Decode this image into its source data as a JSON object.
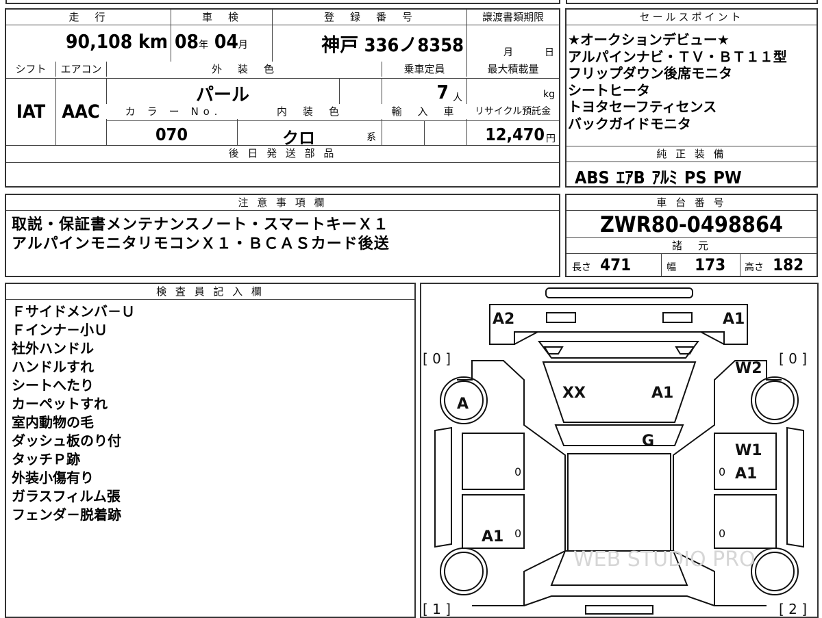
{
  "main": {
    "mileage": {
      "label": "走　行",
      "value": "90,108",
      "unit": "km"
    },
    "inspection": {
      "label": "車　検",
      "year": "08",
      "year_unit": "年",
      "month": "04",
      "month_unit": "月"
    },
    "registration": {
      "label": "登　録　番　号",
      "value": "神戸 336ノ8358"
    },
    "transfer_deadline": {
      "label": "譲渡書類期限",
      "month_unit": "月",
      "day_unit": "日"
    },
    "shift": {
      "label": "シフト",
      "value": "IAT"
    },
    "aircon": {
      "label": "エアコン",
      "value": "AAC"
    },
    "exterior_color": {
      "label": "外　装　色",
      "value": "パール"
    },
    "capacity": {
      "label": "乗車定員",
      "value": "7",
      "unit": "人"
    },
    "max_load": {
      "label": "最大積載量",
      "unit": "kg"
    },
    "color_no": {
      "label": "カ　ラ　ー　N o .",
      "value": "070"
    },
    "interior_color": {
      "label": "内　装　色",
      "value": "クロ",
      "unit": "系"
    },
    "import": {
      "label": "輸　入　車"
    },
    "recycle": {
      "label": "リサイクル預託金",
      "value": "12,470",
      "unit": "円"
    },
    "later_parts": {
      "label": "後 日 発 送 部 品"
    }
  },
  "sales_points": {
    "label": "セールスポイント",
    "lines": [
      "★オークションデビュー★",
      "アルパインナビ・ＴＶ・ＢＴ１１型",
      "フリップダウン後席モニタ",
      "シートヒータ",
      "トヨタセーフティセンス",
      "バックガイドモニタ"
    ]
  },
  "equipment": {
    "label": "純 正 装 備",
    "items": [
      "ABS",
      "ｴｱB",
      "ｱﾙﾐ",
      "PS",
      "PW"
    ]
  },
  "notes": {
    "label": "注 意 事 項 欄",
    "lines": [
      "取説・保証書メンテナンスノート・スマートキーＸ１",
      "アルパインモニタリモコンＸ１・ＢＣＡＳカード後送"
    ]
  },
  "chassis": {
    "label": "車 台 番 号",
    "value": "ZWR80-0498864"
  },
  "specs": {
    "label": "諸　元",
    "length_label": "長さ",
    "length": "471",
    "width_label": "幅",
    "width": "173",
    "height_label": "高さ",
    "height": "182"
  },
  "inspector": {
    "label": "検 査 員 記 入 欄",
    "lines": [
      "Ｆサイドメンバ－Ｕ",
      "Ｆインナ－小Ｕ",
      "社外ハンドル",
      "ハンドルすれ",
      "シートへたり",
      "カーペットすれ",
      "室内動物の毛",
      "ダッシュ板のり付",
      "タッチＰ跡",
      "外装小傷有り",
      "ガラスフィルム張",
      "フェンダ－脱着跡"
    ]
  },
  "diagram": {
    "marks": {
      "a2": "A2",
      "a1_front": "A1",
      "w2": "W2",
      "xx": "XX",
      "a1_glass": "A1",
      "a": "A",
      "g": "G",
      "w1": "W1",
      "a1_right": "A1",
      "a1_rear": "A1"
    },
    "tires": {
      "fl": "[ 0 ]",
      "fr": "[ 0 ]",
      "rl": "[ 1 ]",
      "rr": "[ 2 ]"
    },
    "zeros": [
      "0",
      "0",
      "0",
      "0"
    ],
    "watermark": "WEB STUDIO PRO"
  }
}
